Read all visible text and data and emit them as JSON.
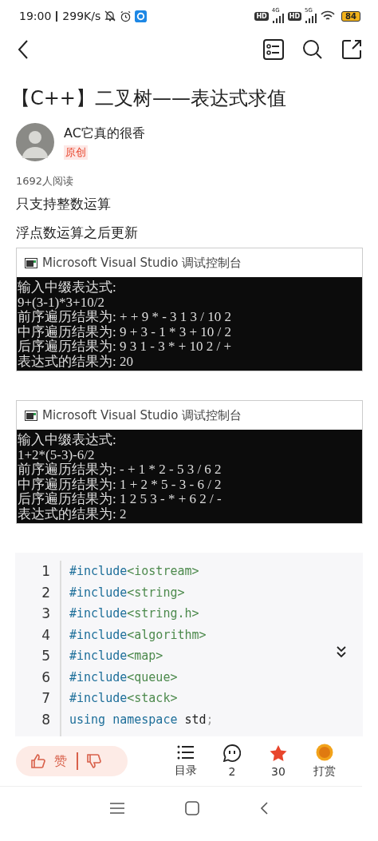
{
  "status_bar": {
    "time": "19:00",
    "speed": "299K/s",
    "networks": [
      {
        "badge": "HD",
        "gen": "4G"
      },
      {
        "badge": "HD",
        "gen": "5G"
      }
    ],
    "battery": "84"
  },
  "title": "【C++】二叉树——表达式求值",
  "author": {
    "name": "AC它真的很香",
    "tag": "原创"
  },
  "reads": "1692人阅读",
  "paragraphs": [
    "只支持整数运算",
    "浮点数运算之后更新"
  ],
  "consoles": [
    {
      "title": "Microsoft Visual Studio 调试控制台",
      "lines": [
        "输入中缀表达式:",
        "9+(3-1)*3+10/2",
        "前序遍历结果为: + + 9 * - 3 1 3 / 10 2",
        "中序遍历结果为: 9 + 3 - 1 * 3 + 10 / 2",
        "后序遍历结果为: 9 3 1 - 3 * + 10 2 / +",
        "表达式的结果为: 20"
      ]
    },
    {
      "title": "Microsoft Visual Studio 调试控制台",
      "lines": [
        "输入中缀表达式:",
        "1+2*(5-3)-6/2",
        "前序遍历结果为: - + 1 * 2 - 5 3 / 6 2",
        "中序遍历结果为: 1 + 2 * 5 - 3 - 6 / 2",
        "后序遍历结果为: 1 2 5 3 - * + 6 2 / -",
        "表达式的结果为: 2"
      ]
    }
  ],
  "code": [
    {
      "number": "1",
      "tokens": [
        {
          "text": "#include",
          "kind": "directive"
        },
        {
          "text": "<iostream>",
          "kind": "header"
        }
      ]
    },
    {
      "number": "2",
      "tokens": [
        {
          "text": "#include",
          "kind": "directive"
        },
        {
          "text": "<string>",
          "kind": "header"
        }
      ]
    },
    {
      "number": "3",
      "tokens": [
        {
          "text": "#include",
          "kind": "directive"
        },
        {
          "text": "<string.h>",
          "kind": "header"
        }
      ]
    },
    {
      "number": "4",
      "tokens": [
        {
          "text": "#include",
          "kind": "directive"
        },
        {
          "text": "<algorithm>",
          "kind": "header"
        }
      ]
    },
    {
      "number": "5",
      "tokens": [
        {
          "text": "#include",
          "kind": "directive"
        },
        {
          "text": "<map>",
          "kind": "header"
        }
      ]
    },
    {
      "number": "6",
      "tokens": [
        {
          "text": "#include",
          "kind": "directive"
        },
        {
          "text": "<queue>",
          "kind": "header"
        }
      ]
    },
    {
      "number": "7",
      "tokens": [
        {
          "text": "#include",
          "kind": "directive"
        },
        {
          "text": "<stack>",
          "kind": "header"
        }
      ]
    },
    {
      "number": "8",
      "tokens": [
        {
          "text": "using namespace",
          "kind": "keyword"
        },
        {
          "text": " std",
          "kind": "plain"
        },
        {
          "text": ";",
          "kind": "punct"
        }
      ]
    }
  ],
  "action_bar": {
    "like": "赞",
    "items": [
      {
        "kind": "toc",
        "label": "目录"
      },
      {
        "kind": "comment",
        "label": "2"
      },
      {
        "kind": "favorite",
        "label": "30"
      },
      {
        "kind": "reward",
        "label": "打赏"
      }
    ]
  }
}
